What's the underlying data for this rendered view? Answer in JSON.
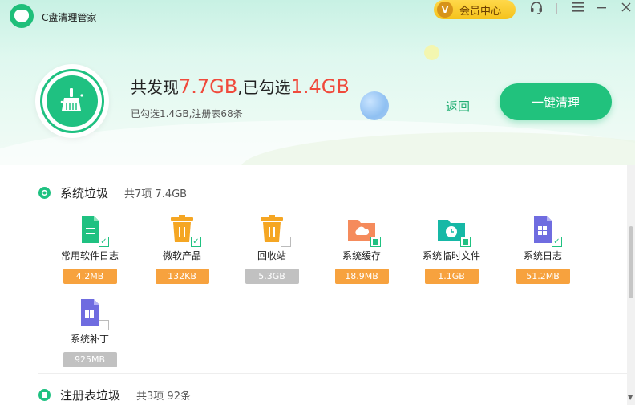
{
  "app": {
    "title": "C盘清理管家"
  },
  "titlebar": {
    "vip_label": "会员中心",
    "vip_badge": "V"
  },
  "summary": {
    "prefix": "共发现",
    "found_size": "7.7GB",
    "middle": ",已勾选",
    "selected_size": "1.4GB",
    "detail": "已勾选1.4GB,注册表68条"
  },
  "actions": {
    "back_label": "返回",
    "clean_label": "一键清理"
  },
  "sections": [
    {
      "title": "系统垃圾",
      "info": "共7项 7.4GB",
      "items": [
        {
          "label": "常用软件日志",
          "size": "4.2MB",
          "icon": "document-icon",
          "check": "checked"
        },
        {
          "label": "微软产品",
          "size": "132KB",
          "icon": "trash-icon",
          "check": "checked"
        },
        {
          "label": "回收站",
          "size": "5.3GB",
          "icon": "trash-icon",
          "check": "unchecked"
        },
        {
          "label": "系统缓存",
          "size": "18.9MB",
          "icon": "cloud-folder-icon",
          "check": "partial"
        },
        {
          "label": "系统临时文件",
          "size": "1.1GB",
          "icon": "clock-folder-icon",
          "check": "partial"
        },
        {
          "label": "系统日志",
          "size": "51.2MB",
          "icon": "windows-doc-icon",
          "check": "checked"
        },
        {
          "label": "系统补丁",
          "size": "925MB",
          "icon": "windows-doc-icon",
          "check": "unchecked"
        }
      ]
    },
    {
      "title": "注册表垃圾",
      "info": "共3项 92条"
    }
  ],
  "colors": {
    "accent": "#1fc181",
    "danger": "#f04a3c",
    "size_badge": "#f7a23e",
    "size_badge_off": "#c1c1c1",
    "vip": "#f5c21b"
  }
}
